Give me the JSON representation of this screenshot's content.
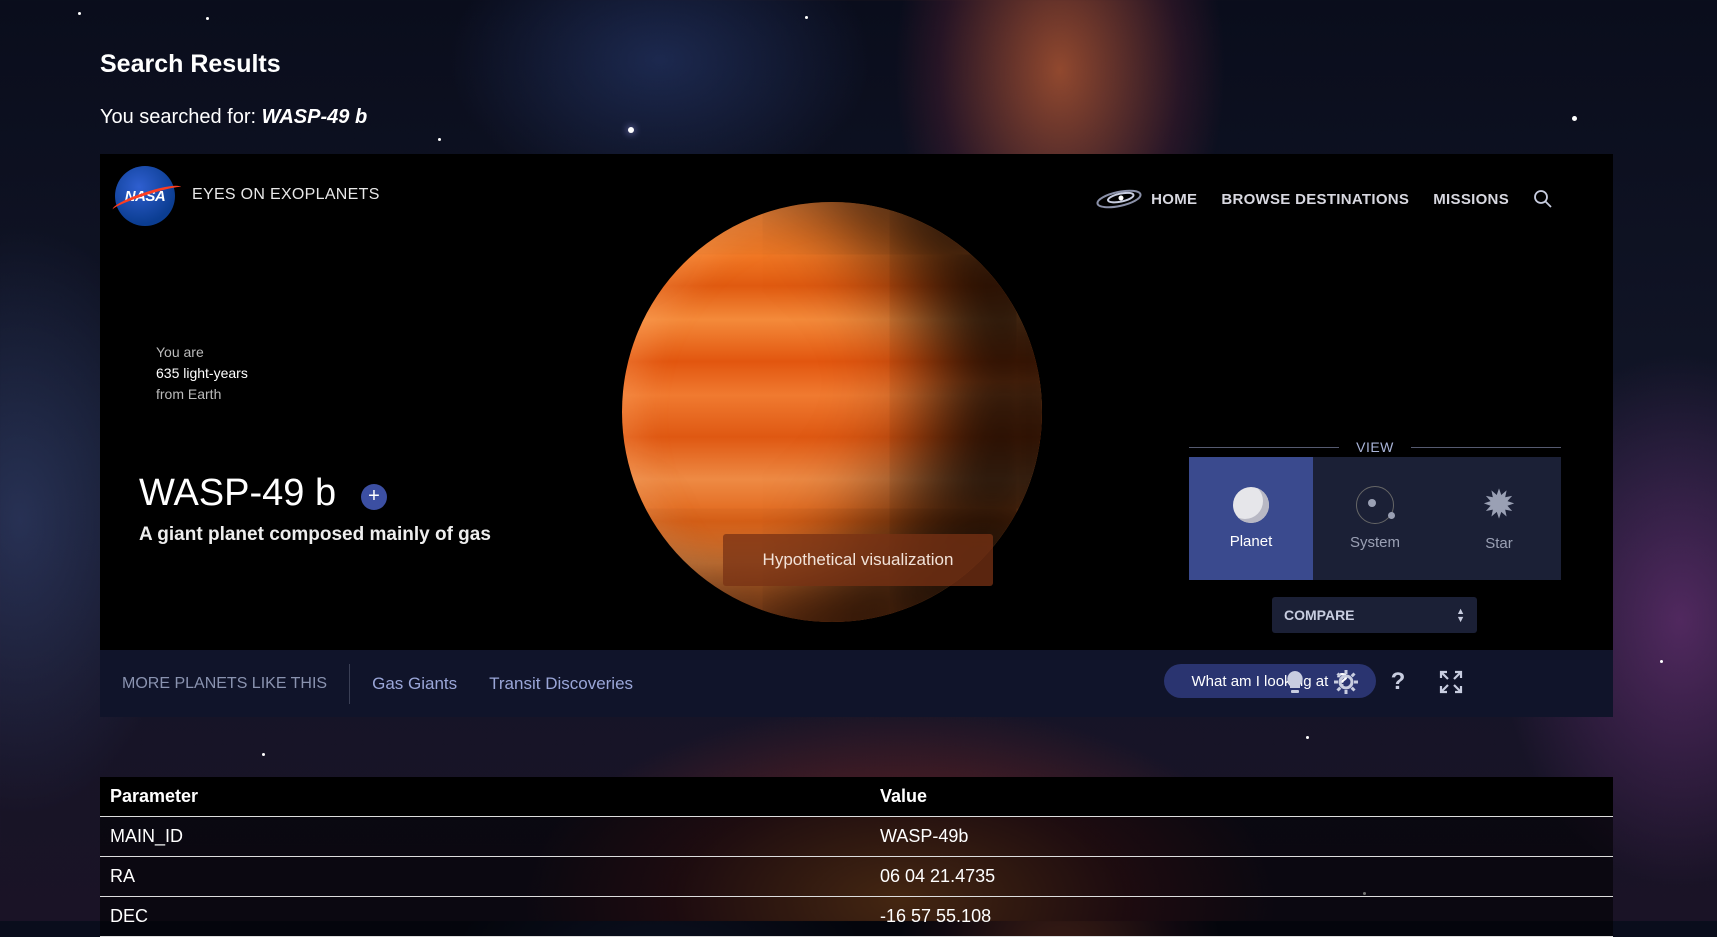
{
  "page": {
    "title": "Search Results",
    "search_prefix": "You searched for: ",
    "search_term": "WASP-49 b"
  },
  "header": {
    "logo": "NASA",
    "app_name": "EYES ON EXOPLANETS",
    "nav": [
      "HOME",
      "BROWSE DESTINATIONS",
      "MISSIONS"
    ]
  },
  "distance": {
    "line1": "You are",
    "line2": "635 light-years",
    "line3": "from Earth"
  },
  "planet": {
    "name": "WASP-49 b",
    "description": "A giant planet composed mainly of gas",
    "add_icon": "+",
    "visual_note": "Hypothetical visualization"
  },
  "view": {
    "label": "VIEW",
    "options": [
      {
        "label": "Planet",
        "icon": "planet-icon",
        "active": true
      },
      {
        "label": "System",
        "icon": "system-icon",
        "active": false
      },
      {
        "label": "Star",
        "icon": "star-icon",
        "active": false
      }
    ],
    "compare_label": "COMPARE"
  },
  "bottom_bar": {
    "more_label": "MORE PLANETS LIKE THIS",
    "tags": [
      "Gas Giants",
      "Transit Discoveries"
    ],
    "help_button": "What am I looking at",
    "help_q": "?"
  },
  "table": {
    "headers": [
      "Parameter",
      "Value"
    ],
    "rows": [
      [
        "MAIN_ID",
        "WASP-49b"
      ],
      [
        "RA",
        "06 04 21.4735"
      ],
      [
        "DEC",
        "-16 57 55.108"
      ]
    ]
  },
  "colors": {
    "accent": "#3a4a8e",
    "planet": "#e8611a",
    "bar": "#10142a"
  }
}
